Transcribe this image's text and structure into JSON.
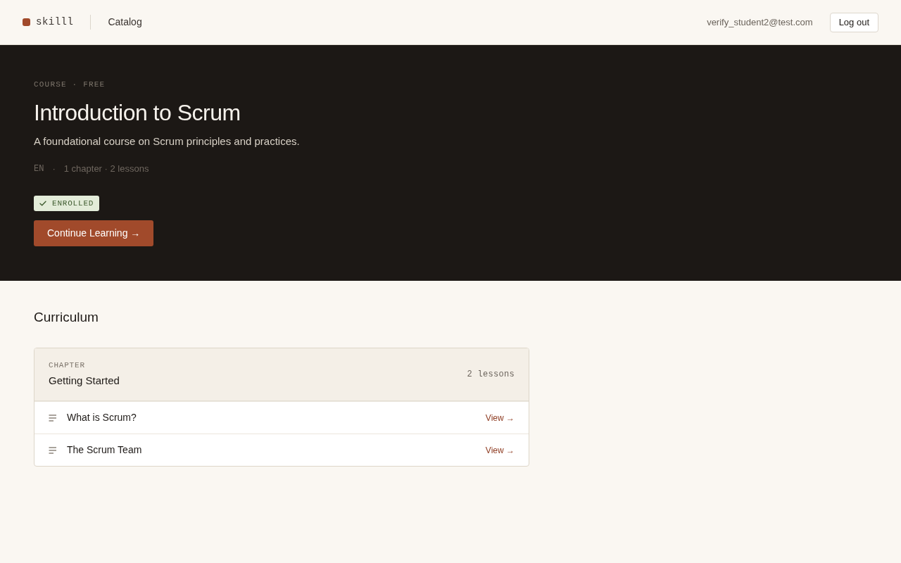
{
  "navbar": {
    "brand": "skilll",
    "links": [
      {
        "label": "Catalog",
        "selected": false
      }
    ],
    "user_email": "verify_student2@test.com",
    "logout_button": "Log out"
  },
  "hero": {
    "eyebrow": "COURSE · FREE",
    "title": "Introduction to Scrum",
    "description": "A foundational course on Scrum principles and practices.",
    "language": "EN",
    "meta_separator": "·",
    "stats": "1 chapter · 2 lessons",
    "enrollment_badge": "ENROLLED",
    "cta_button": "Continue Learning →"
  },
  "curriculum": {
    "heading": "Curriculum",
    "chapters": [
      {
        "label": "CHAPTER",
        "title": "Getting Started",
        "lesson_count": "2 lessons",
        "lessons": [
          {
            "title": "What is Scrum?",
            "link": "View →"
          },
          {
            "title": "The Scrum Team",
            "link": "View →"
          }
        ]
      }
    ]
  }
}
